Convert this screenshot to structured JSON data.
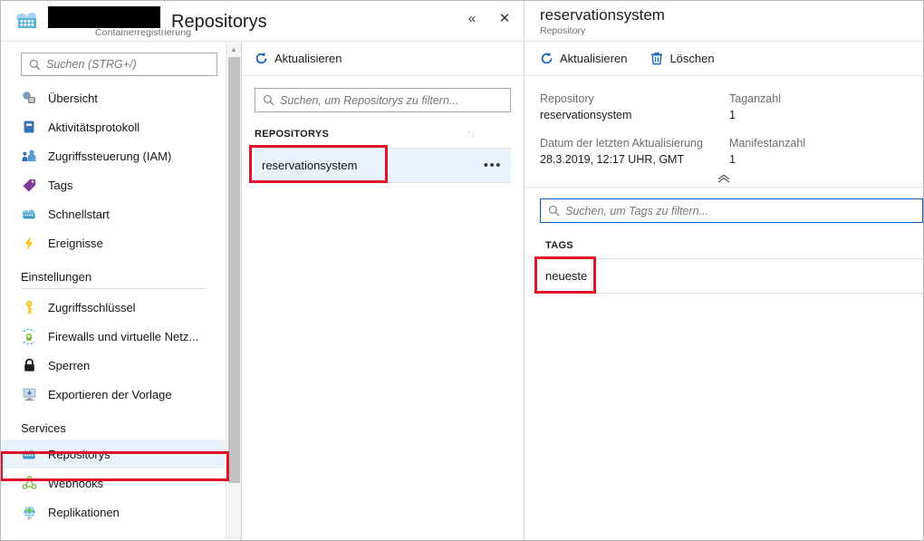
{
  "registry_blade": {
    "icon": "container-registry-icon",
    "redacted_name": "",
    "title": "Repositorys",
    "subtitle": "Containerregistrierung",
    "collapse_label": "«",
    "close_label": "✕",
    "nav_search": {
      "placeholder": "Suchen (STRG+/)",
      "value": "",
      "icon": "search-icon"
    },
    "nav_collapse_label": "«",
    "nav": [
      {
        "label": "Übersicht",
        "icon": "overview-icon",
        "selected": false
      },
      {
        "label": "Aktivitätsprotokoll",
        "icon": "activity-log-icon",
        "selected": false
      },
      {
        "label": "Zugriffssteuerung (IAM)",
        "icon": "access-control-icon",
        "selected": false
      },
      {
        "label": "Tags",
        "icon": "tag-icon",
        "selected": false
      },
      {
        "label": "Schnellstart",
        "icon": "quickstart-icon",
        "selected": false
      },
      {
        "label": "Ereignisse",
        "icon": "events-icon",
        "selected": false
      }
    ],
    "section_settings": "Einstellungen",
    "nav_settings": [
      {
        "label": "Zugriffsschlüssel",
        "icon": "key-icon",
        "selected": false
      },
      {
        "label": "Firewalls und virtuelle Netz...",
        "icon": "firewall-icon",
        "selected": false
      },
      {
        "label": "Sperren",
        "icon": "lock-icon",
        "selected": false
      },
      {
        "label": "Exportieren der Vorlage",
        "icon": "export-template-icon",
        "selected": false
      }
    ],
    "section_services": "Services",
    "nav_services": [
      {
        "label": "Repositorys",
        "icon": "container-registry-icon",
        "selected": true
      },
      {
        "label": "Webhooks",
        "icon": "webhooks-icon",
        "selected": false
      },
      {
        "label": "Replikationen",
        "icon": "replications-icon",
        "selected": false
      }
    ]
  },
  "repos_panel": {
    "refresh_label": "Aktualisieren",
    "refresh_icon": "refresh-icon",
    "filter": {
      "placeholder": "Suchen, um Repositorys zu filtern...",
      "value": "",
      "icon": "search-icon"
    },
    "column_header": "REPOSITORYS",
    "sort_icon": "↑↓",
    "rows": [
      {
        "name": "reservationsystem",
        "menu": "•••",
        "selected": true
      }
    ]
  },
  "repository_blade": {
    "title": "reservationsystem",
    "subtitle": "Repository",
    "commands": [
      {
        "label": "Aktualisieren",
        "icon": "refresh-icon"
      },
      {
        "label": "Löschen",
        "icon": "trash-icon"
      }
    ],
    "properties_left": [
      {
        "label": "Repository",
        "value": "reservationsystem"
      },
      {
        "label": "Datum der letzten Aktualisierung",
        "value": "28.3.2019, 12:17 UHR, GMT"
      }
    ],
    "properties_right": [
      {
        "label": "Taganzahl",
        "value": "1"
      },
      {
        "label": "Manifestanzahl",
        "value": "1"
      }
    ],
    "collapse_icon": "«",
    "tags_filter": {
      "placeholder": "Suchen, um Tags zu filtern...",
      "value": "",
      "icon": "search-icon",
      "focused": true
    },
    "tags_column_header": "TAGS",
    "tags": [
      {
        "name": "neueste"
      }
    ]
  },
  "annotations": {
    "color": "#e0102b",
    "boxes": [
      "sidebar-repositorys",
      "repository-list-row-name",
      "tag-name"
    ]
  }
}
